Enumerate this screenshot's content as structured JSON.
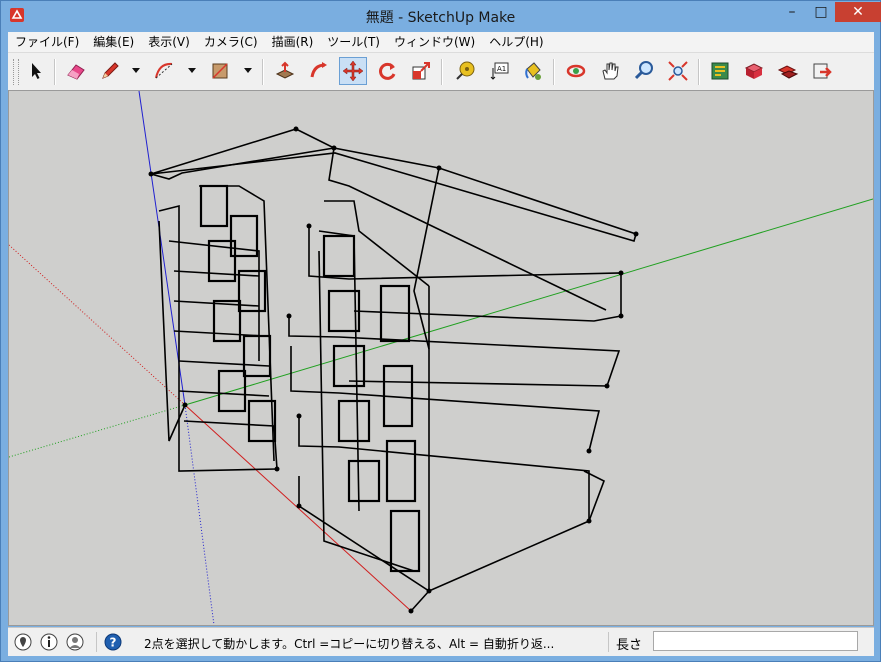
{
  "window": {
    "title": "無題 - SketchUp Make"
  },
  "menu": {
    "items": [
      "ファイル(F)",
      "編集(E)",
      "表示(V)",
      "カメラ(C)",
      "描画(R)",
      "ツール(T)",
      "ウィンドウ(W)",
      "ヘルプ(H)"
    ]
  },
  "toolbar": {
    "active_tool": "move-tool",
    "tools": [
      "select-icon",
      "eraser-icon",
      "pencil-icon",
      "arc-icon",
      "rectangle-icon",
      "push-pull-icon",
      "follow-me-icon",
      "move-icon",
      "rotate-icon",
      "scale-icon",
      "tape-measure-icon",
      "text-icon",
      "paint-bucket-icon",
      "orbit-icon",
      "pan-icon",
      "zoom-icon",
      "zoom-extents-icon",
      "warehouse-icon",
      "extension-icon",
      "components-icon",
      "share-icon"
    ]
  },
  "status": {
    "message": "2点を選択して動かします。Ctrl =コピーに切り替える、Alt = 自動折り返...",
    "measure_label": "長さ",
    "measure_value": ""
  },
  "colors": {
    "titlebar": "#7aaee0",
    "close_button": "#c84031",
    "viewport_bg": "#cfcfcd",
    "axis_red": "#d02020",
    "axis_green": "#20a020",
    "axis_blue": "#2020d0"
  }
}
